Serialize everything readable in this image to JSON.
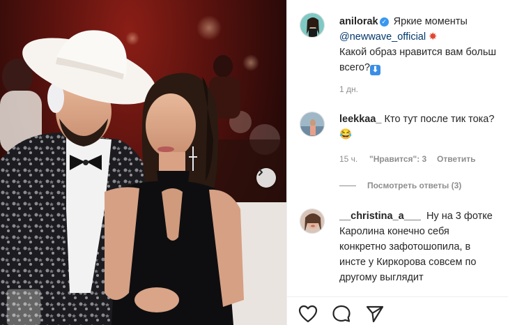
{
  "post": {
    "author": "anilorak",
    "caption_text": "Яркие моменты",
    "caption_mention": "@newwave_official",
    "caption_line2": "Какой образ нравится вам больш",
    "caption_line3": "всего?",
    "arrow_emoji": "⬇",
    "time": "1 дн."
  },
  "comments": [
    {
      "user": "leekkaa_",
      "text": "Кто тут после тик тока?",
      "emoji": "😂",
      "time": "15 ч.",
      "likes": "\"Нравится\": 3",
      "reply": "Ответить",
      "view_replies": "Посмотреть ответы (3)"
    },
    {
      "user": "__christina_a___",
      "text_line1": "Ну на 3 фотке",
      "text_line2": "Каролина конечно себя",
      "text_line3": "конкретно зафотошопила, в",
      "text_line4": "инсте у Киркорова совсем по",
      "text_line5": "другому выглядит"
    }
  ],
  "icons": {
    "like": "heart-icon",
    "comment": "comment-icon",
    "share": "share-icon",
    "next": "chevron-right-icon",
    "verified": "verified-badge-icon",
    "explosion": "collision-emoji"
  },
  "colors": {
    "verified": "#3897f0",
    "mention": "#00376b",
    "meta": "#8e8e8e",
    "text": "#262626"
  }
}
